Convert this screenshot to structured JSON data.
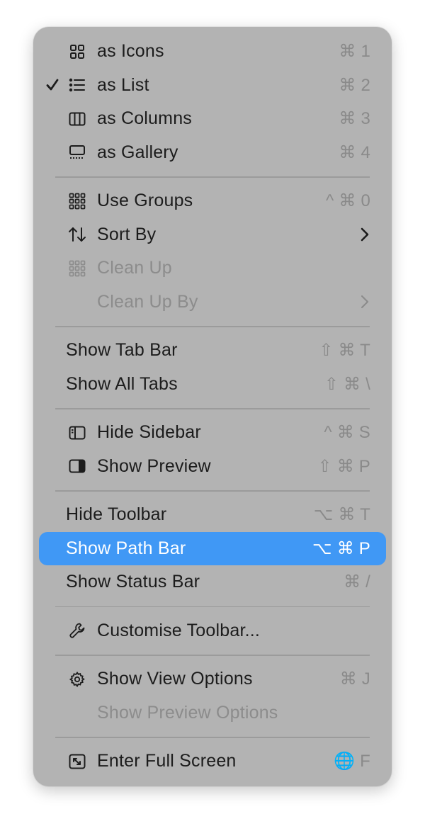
{
  "menu": {
    "view_mode": [
      {
        "label": "as Icons",
        "shortcut": "⌘ 1",
        "checked": false,
        "icon": "grid-icon"
      },
      {
        "label": "as List",
        "shortcut": "⌘ 2",
        "checked": true,
        "icon": "list-icon"
      },
      {
        "label": "as Columns",
        "shortcut": "⌘ 3",
        "checked": false,
        "icon": "columns-icon"
      },
      {
        "label": "as Gallery",
        "shortcut": "⌘ 4",
        "checked": false,
        "icon": "gallery-icon"
      }
    ],
    "arrange": [
      {
        "label": "Use Groups",
        "shortcut": "^ ⌘ 0",
        "icon": "groups-icon"
      },
      {
        "label": "Sort By",
        "submenu": true,
        "icon": "sort-icon"
      },
      {
        "label": "Clean Up",
        "disabled": true,
        "icon": "clean-up-icon"
      },
      {
        "label": "Clean Up By",
        "disabled": true,
        "submenu": true
      }
    ],
    "tabs": [
      {
        "label": "Show Tab Bar",
        "shortcut": "⇧ ⌘ T"
      },
      {
        "label": "Show All Tabs",
        "shortcut": "⇧ ⌘ \\"
      }
    ],
    "panes": [
      {
        "label": "Hide Sidebar",
        "shortcut": "^ ⌘ S",
        "icon": "sidebar-icon"
      },
      {
        "label": "Show Preview",
        "shortcut": "⇧ ⌘ P",
        "icon": "preview-icon"
      }
    ],
    "bars": [
      {
        "label": "Hide Toolbar",
        "shortcut": "⌥ ⌘ T"
      },
      {
        "label": "Show Path Bar",
        "shortcut": "⌥ ⌘ P",
        "highlighted": true
      },
      {
        "label": "Show Status Bar",
        "shortcut": "⌘ /"
      }
    ],
    "customise": [
      {
        "label": "Customise Toolbar...",
        "icon": "wrench-icon"
      }
    ],
    "options": [
      {
        "label": "Show View Options",
        "shortcut": "⌘ J",
        "icon": "gear-icon"
      },
      {
        "label": "Show Preview Options",
        "disabled": true
      }
    ],
    "fullscreen": [
      {
        "label": "Enter Full Screen",
        "shortcut": "🌐 F",
        "icon": "fullscreen-icon"
      }
    ]
  },
  "colors": {
    "menu_background": "#b3b3b3",
    "highlight": "#4098f5",
    "text": "#1c1c1c",
    "disabled_text": "#8c8c8c",
    "shortcut_text": "#8a8a8a"
  }
}
